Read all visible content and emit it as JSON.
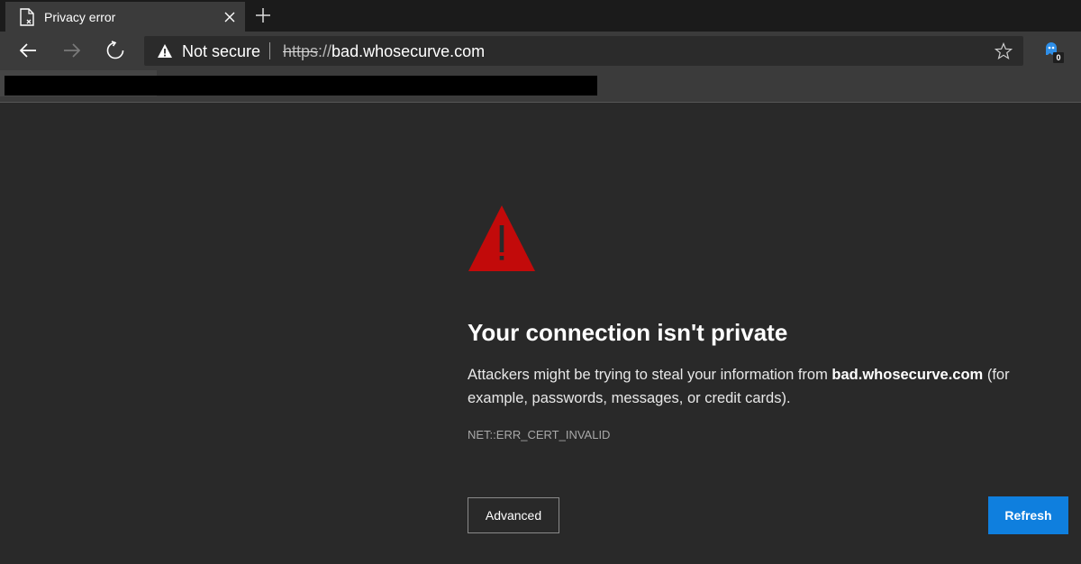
{
  "tab": {
    "title": "Privacy error",
    "icon": "broken-page-icon",
    "close_icon": "close-icon",
    "new_tab_icon": "plus-icon"
  },
  "toolbar": {
    "back_icon": "back-arrow-icon",
    "forward_icon": "forward-arrow-icon",
    "refresh_icon": "refresh-icon",
    "security_label": "Not secure",
    "security_icon": "warning-triangle-icon",
    "url_scheme": "https",
    "url_separator": "://",
    "url_host": "bad.whosecurve.com",
    "favorite_icon": "star-icon",
    "extension_icon": "ghost-extension-icon",
    "extension_badge": "0"
  },
  "page": {
    "warning_icon": "warning-triangle-icon",
    "heading": "Your connection isn't private",
    "desc_before": "Attackers might be trying to steal your information from ",
    "desc_host": "bad.whosecurve.com",
    "desc_after": " (for example, passwords, messages, or credit cards).",
    "error_code": "NET::ERR_CERT_INVALID",
    "advanced_label": "Advanced",
    "refresh_label": "Refresh"
  },
  "colors": {
    "page_background": "#292929",
    "warning_red": "#c20a0a",
    "refresh_button": "#0f7fde"
  }
}
